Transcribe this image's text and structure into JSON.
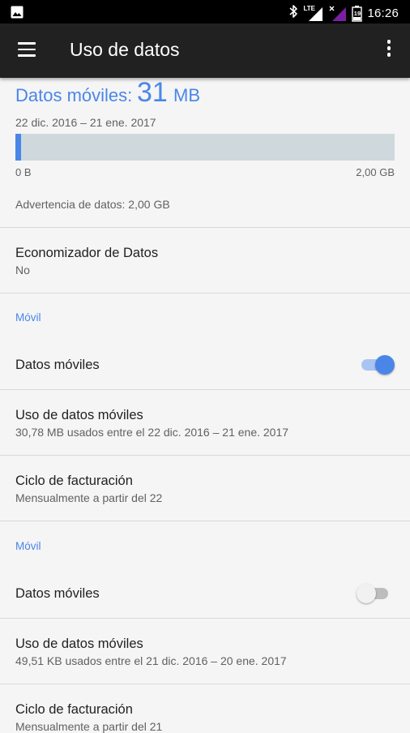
{
  "status_bar": {
    "time": "16:26",
    "network": "LTE",
    "battery_level": "19",
    "icons": [
      "image-icon",
      "bluetooth-icon",
      "lte-signal-icon",
      "no-signal-icon",
      "battery-icon"
    ]
  },
  "toolbar": {
    "title": "Uso de datos",
    "menu_icon": "hamburger-menu-icon",
    "more_icon": "more-vert-icon"
  },
  "usage": {
    "label": "Datos móviles:",
    "value": "31",
    "unit": "MB",
    "date_range": "22 dic. 2016 – 21 ene. 2017",
    "bar_min": "0 B",
    "bar_max": "2,00 GB",
    "bar_fill_fraction": 0.015,
    "warning": "Advertencia de datos: 2,00 GB"
  },
  "economizer": {
    "title": "Economizador de Datos",
    "value": "No"
  },
  "sections": [
    {
      "header": "Móvil",
      "mobile_data_label": "Datos móviles",
      "mobile_data_enabled": true,
      "usage_title": "Uso de datos móviles",
      "usage_summary": "30,78 MB usados entre el 22 dic. 2016 – 21 ene. 2017",
      "billing_title": "Ciclo de facturación",
      "billing_summary": "Mensualmente a partir del 22"
    },
    {
      "header": "Móvil",
      "mobile_data_label": "Datos móviles",
      "mobile_data_enabled": false,
      "usage_title": "Uso de datos móviles",
      "usage_summary": "49,51 KB usados entre el 21 dic. 2016 – 20 ene. 2017",
      "billing_title": "Ciclo de facturación",
      "billing_summary": "Mensualmente a partir del 21"
    }
  ],
  "colors": {
    "accent": "#4a86e8",
    "toolbar": "#212121",
    "background": "#f5f5f5"
  }
}
